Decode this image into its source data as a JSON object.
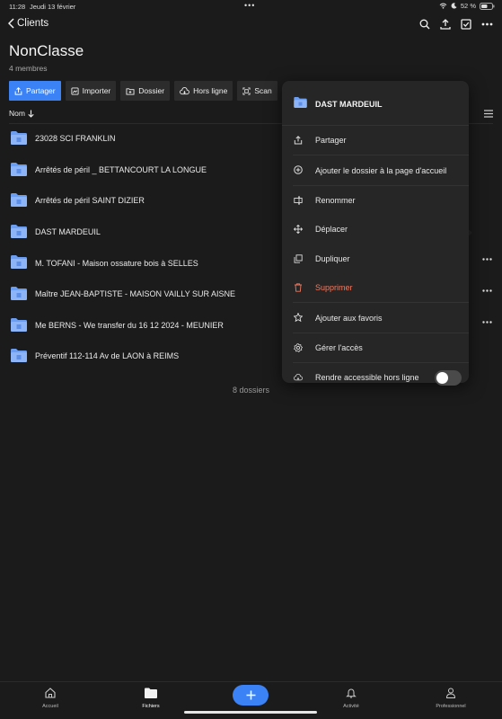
{
  "status_bar": {
    "time": "11:28",
    "date": "Jeudi 13 février",
    "battery": "52 %",
    "dots": "•••"
  },
  "nav": {
    "back_label": "Clients"
  },
  "header": {
    "title": "NonClasse",
    "subtitle": "4 membres"
  },
  "toolbar": {
    "share": "Partager",
    "import": "Importer",
    "folder": "Dossier",
    "offline": "Hors ligne",
    "scan": "Scan"
  },
  "sort": {
    "label": "Nom"
  },
  "files": [
    {
      "name": "23028 SCI FRANKLIN"
    },
    {
      "name": "Arrêtés de péril _ BETTANCOURT LA LONGUE"
    },
    {
      "name": "Arrêtés de péril SAINT DIZIER"
    },
    {
      "name": "DAST MARDEUIL"
    },
    {
      "name": "M. TOFANI - Maison ossature bois à SELLES"
    },
    {
      "name": "Maître JEAN-BAPTISTE - MAISON VAILLY SUR AISNE"
    },
    {
      "name": "Me BERNS - We transfer du 16 12 2024 - MEUNIER"
    },
    {
      "name": "Préventif 112-114 Av de LAON à REIMS"
    }
  ],
  "folder_count": "8 dossiers",
  "context_menu": {
    "title": "DAST MARDEUIL",
    "items": [
      {
        "label": "Partager",
        "icon": "share-icon"
      },
      {
        "label": "Ajouter le dossier à la page d'accueil",
        "icon": "plus-circle-icon"
      },
      {
        "label": "Renommer",
        "icon": "rename-icon"
      },
      {
        "label": "Déplacer",
        "icon": "move-icon"
      },
      {
        "label": "Dupliquer",
        "icon": "duplicate-icon"
      },
      {
        "label": "Supprimer",
        "icon": "trash-icon"
      },
      {
        "label": "Ajouter aux favoris",
        "icon": "star-icon"
      },
      {
        "label": "Gérer l'accès",
        "icon": "gear-icon"
      },
      {
        "label": "Rendre accessible hors ligne",
        "icon": "offline-icon"
      }
    ],
    "offline_enabled": false
  },
  "tabs": [
    {
      "label": "Accueil"
    },
    {
      "label": "Fichiers"
    },
    {
      "label": "Activité"
    },
    {
      "label": "Professionnel"
    }
  ],
  "colors": {
    "accent": "#3b82f6",
    "danger": "#f07a61",
    "folder": "#6b9ef3"
  }
}
